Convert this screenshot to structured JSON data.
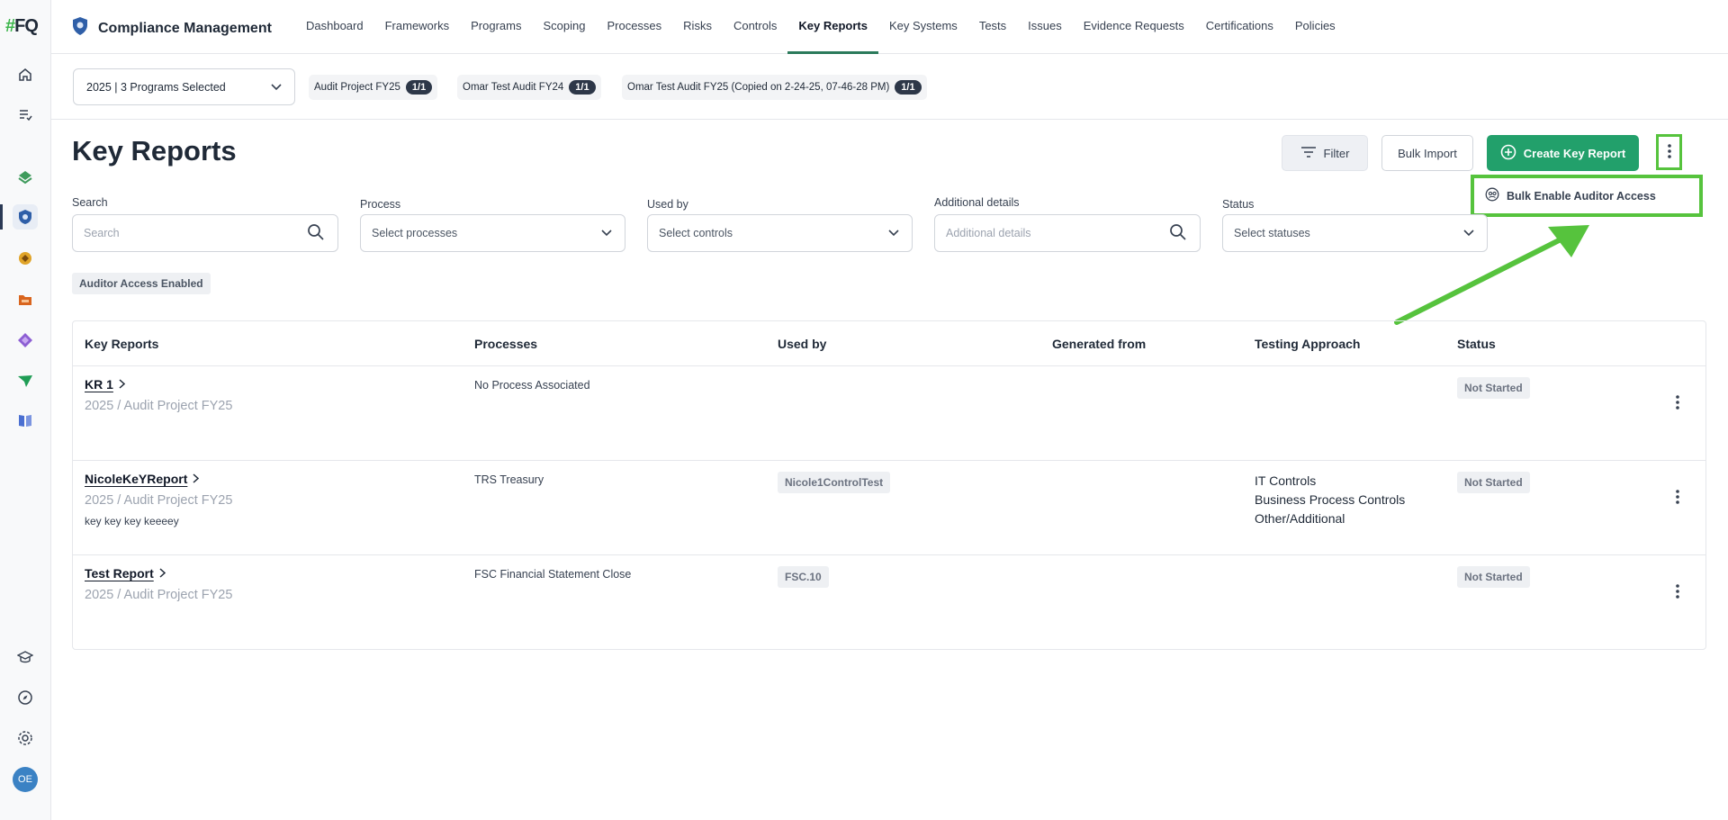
{
  "sidebar": {
    "logo": {
      "hash": "#",
      "text": "FQ"
    },
    "avatar_initials": "OE",
    "icons": [
      "home-icon",
      "tasks-icon",
      "layers-icon",
      "compliance-icon",
      "risk-icon",
      "folder-icon",
      "diamond-icon",
      "send-icon",
      "book-icon",
      "graduation-icon",
      "compass-icon",
      "gear-icon"
    ]
  },
  "topnav": {
    "brand": "Compliance Management",
    "tabs": [
      {
        "label": "Dashboard"
      },
      {
        "label": "Frameworks"
      },
      {
        "label": "Programs"
      },
      {
        "label": "Scoping"
      },
      {
        "label": "Processes"
      },
      {
        "label": "Risks"
      },
      {
        "label": "Controls"
      },
      {
        "label": "Key Reports",
        "active": true
      },
      {
        "label": "Key Systems"
      },
      {
        "label": "Tests"
      },
      {
        "label": "Issues"
      },
      {
        "label": "Evidence Requests"
      },
      {
        "label": "Certifications"
      },
      {
        "label": "Policies"
      }
    ]
  },
  "programbar": {
    "selected": "2025 | 3 Programs Selected",
    "chips": [
      {
        "label": "Audit Project FY25",
        "count": "1/1"
      },
      {
        "label": "Omar Test Audit FY24",
        "count": "1/1"
      },
      {
        "label": "Omar Test Audit FY25 (Copied on 2-24-25, 07-46-28 PM)",
        "count": "1/1"
      }
    ]
  },
  "header": {
    "title": "Key Reports",
    "filter_label": "Filter",
    "bulk_import_label": "Bulk Import",
    "create_label": "Create Key Report",
    "menu_item": "Bulk Enable Auditor Access"
  },
  "filters": {
    "search": {
      "label": "Search",
      "placeholder": "Search"
    },
    "process": {
      "label": "Process",
      "placeholder": "Select processes"
    },
    "used_by": {
      "label": "Used by",
      "placeholder": "Select controls"
    },
    "additional": {
      "label": "Additional details",
      "placeholder": "Additional details"
    },
    "status": {
      "label": "Status",
      "placeholder": "Select statuses"
    },
    "active_tag": "Auditor Access Enabled"
  },
  "table": {
    "columns": [
      "Key Reports",
      "Processes",
      "Used by",
      "Generated from",
      "Testing Approach",
      "Status"
    ],
    "rows": [
      {
        "name": "KR 1",
        "sub": "2025 / Audit Project FY25",
        "desc": "",
        "process": "No Process Associated",
        "used_by": "",
        "generated_from": "",
        "approach": [],
        "status": "Not Started"
      },
      {
        "name": "NicoleKeYReport",
        "sub": "2025 / Audit Project FY25",
        "desc": "key key key keeeey",
        "process": "TRS Treasury",
        "used_by": "Nicole1ControlTest",
        "generated_from": "",
        "approach": [
          "IT Controls",
          "Business Process Controls",
          "Other/Additional"
        ],
        "status": "Not Started"
      },
      {
        "name": "Test Report",
        "sub": "2025 / Audit Project FY25",
        "desc": "",
        "process": "FSC Financial Statement Close",
        "used_by": "FSC.10",
        "generated_from": "",
        "approach": [],
        "status": "Not Started"
      }
    ]
  },
  "colors": {
    "accent_green": "#22a06b",
    "highlight_green": "#56c33d",
    "active_tab_underline": "#2b7a5b"
  }
}
